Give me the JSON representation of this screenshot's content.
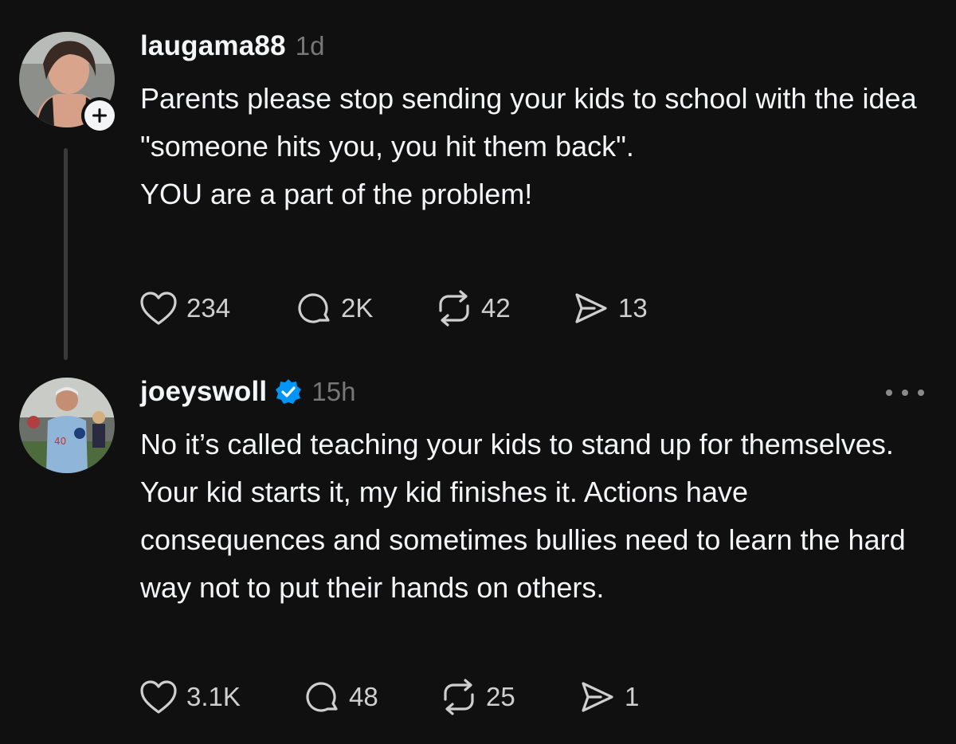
{
  "posts": [
    {
      "username": "laugama88",
      "time": "1d",
      "paragraphs": [
        "Parents please stop sending your kids to school with the idea \"someone hits you, you hit them back\".",
        "YOU are a part of the problem!"
      ],
      "likes": "234",
      "replies": "2K",
      "reposts": "42",
      "shares": "13"
    },
    {
      "username": "joeyswoll",
      "time": "15h",
      "paragraphs": [
        "No it’s called teaching your kids to stand up for themselves. Your kid starts it, my kid finishes it. Actions have consequences and sometimes bullies need to learn the hard way not to put their hands on others."
      ],
      "likes": "3.1K",
      "replies": "48",
      "reposts": "25",
      "shares": "1"
    }
  ],
  "colors": {
    "background": "#101010",
    "text": "#f3f5f7",
    "muted": "#777777",
    "verified": "#0095f6"
  },
  "icons": {
    "like": "heart-icon",
    "reply": "comment-icon",
    "repost": "repost-icon",
    "share": "share-icon",
    "follow": "plus-icon",
    "more": "more-dots-icon",
    "verified": "verified-badge-icon"
  }
}
